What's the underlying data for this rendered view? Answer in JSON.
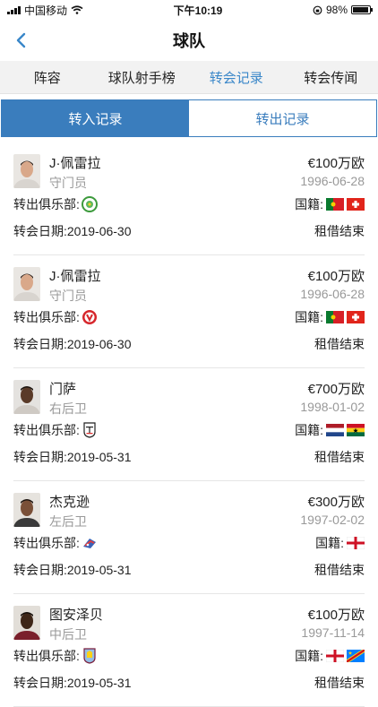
{
  "status_bar": {
    "carrier": "中国移动",
    "time": "下午10:19",
    "battery": "98%"
  },
  "nav": {
    "title": "球队"
  },
  "tabs": [
    {
      "label": "阵容",
      "active": false
    },
    {
      "label": "球队射手榜",
      "active": false
    },
    {
      "label": "转会记录",
      "active": true
    },
    {
      "label": "转会传闻",
      "active": false
    }
  ],
  "segment": {
    "in_label": "转入记录",
    "out_label": "转出记录",
    "selected": "in"
  },
  "labels": {
    "from_club": "转出俱乐部:",
    "nationality": "国籍:",
    "date_prefix": "转会日期:"
  },
  "transfers": [
    {
      "name": "J·佩雷拉",
      "position": "守门员",
      "fee": "€100万欧",
      "dob": "1996-06-28",
      "date": "2019-06-30",
      "type": "租借结束",
      "club_badge": "green-badge-icon",
      "flags": [
        "portugal",
        "switzerland"
      ]
    },
    {
      "name": "J·佩雷拉",
      "position": "守门员",
      "fee": "€100万欧",
      "dob": "1996-06-28",
      "date": "2019-06-30",
      "type": "租借结束",
      "club_badge": "red-white-badge-icon",
      "flags": [
        "portugal",
        "switzerland"
      ]
    },
    {
      "name": "门萨",
      "position": "右后卫",
      "fee": "€700万欧",
      "dob": "1998-01-02",
      "date": "2019-05-31",
      "type": "租借结束",
      "club_badge": "fulham-badge-icon",
      "flags": [
        "netherlands",
        "ghana"
      ]
    },
    {
      "name": "杰克逊",
      "position": "左后卫",
      "fee": "€300万欧",
      "dob": "1997-02-02",
      "date": "2019-05-31",
      "type": "租借结束",
      "club_badge": "blue-red-badge-icon",
      "flags": [
        "england"
      ]
    },
    {
      "name": "图安泽贝",
      "position": "中后卫",
      "fee": "€100万欧",
      "dob": "1997-11-14",
      "date": "2019-05-31",
      "type": "租借结束",
      "club_badge": "villa-badge-icon",
      "flags": [
        "england",
        "dr-congo"
      ]
    }
  ],
  "colors": {
    "accent": "#3a87c9",
    "segment_blue": "#3a7dbd"
  }
}
